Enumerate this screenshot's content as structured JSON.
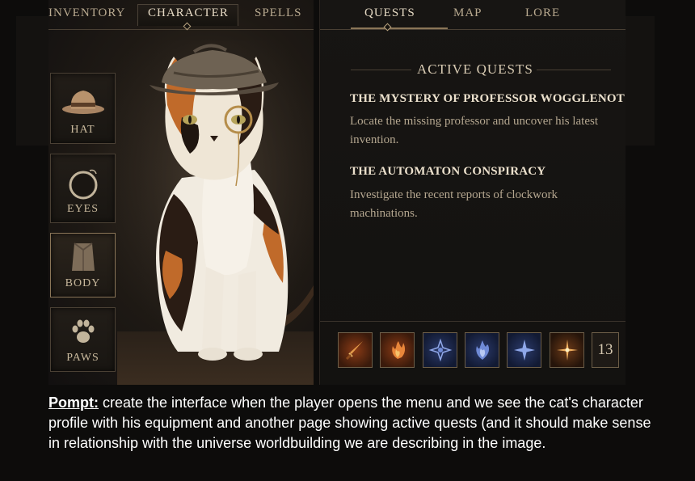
{
  "tabs_left": [
    {
      "label": "INVENTORY",
      "active": false
    },
    {
      "label": "CHARACTER",
      "active": true
    },
    {
      "label": "SPELLS",
      "active": false
    }
  ],
  "tabs_right": [
    {
      "label": "QUESTS",
      "active": true
    },
    {
      "label": "MAP",
      "active": false
    },
    {
      "label": "LORE",
      "active": false
    }
  ],
  "equipment_slots": [
    {
      "label": "HAT",
      "icon": "hat-icon",
      "selected": false
    },
    {
      "label": "EYES",
      "icon": "monocle-icon",
      "selected": false
    },
    {
      "label": "BODY",
      "icon": "cloak-icon",
      "selected": true
    },
    {
      "label": "PAWS",
      "icon": "paw-icon",
      "selected": false
    }
  ],
  "character": {
    "portrait": "calico cat wearing deerstalker hat and monocle"
  },
  "quests": {
    "heading": "ACTIVE QUESTS",
    "items": [
      {
        "title": "THE MYSTERY OF PROFESSOR WOGGLENOT",
        "description": "Locate the missing professor and uncover his latest invention."
      },
      {
        "title": "THE AUTOMATON CONSPIRACY",
        "description": "Investigate the recent reports of clockwork machinations."
      }
    ]
  },
  "abilities": [
    {
      "icon": "dagger-icon",
      "style": "fire"
    },
    {
      "icon": "flame-claw-icon",
      "style": "fire"
    },
    {
      "icon": "star-rune-icon",
      "style": "blue"
    },
    {
      "icon": "blue-flame-icon",
      "style": "blue"
    },
    {
      "icon": "four-point-star-icon",
      "style": "blue"
    },
    {
      "icon": "sparkle-icon",
      "style": "gold"
    }
  ],
  "ability_count": "13",
  "prompt": {
    "label": "Pompt:",
    "text": " create the interface when the player opens the menu and we see the cat's character profile with his equipment and another page showing active quests (and it should make sense in relationship with the universe worldbuilding we are describing in the image."
  },
  "colors": {
    "accent": "#b8a37f",
    "background": "#0d0c0b",
    "fire": "#8a3b16",
    "arcane": "#2b3a6a"
  }
}
